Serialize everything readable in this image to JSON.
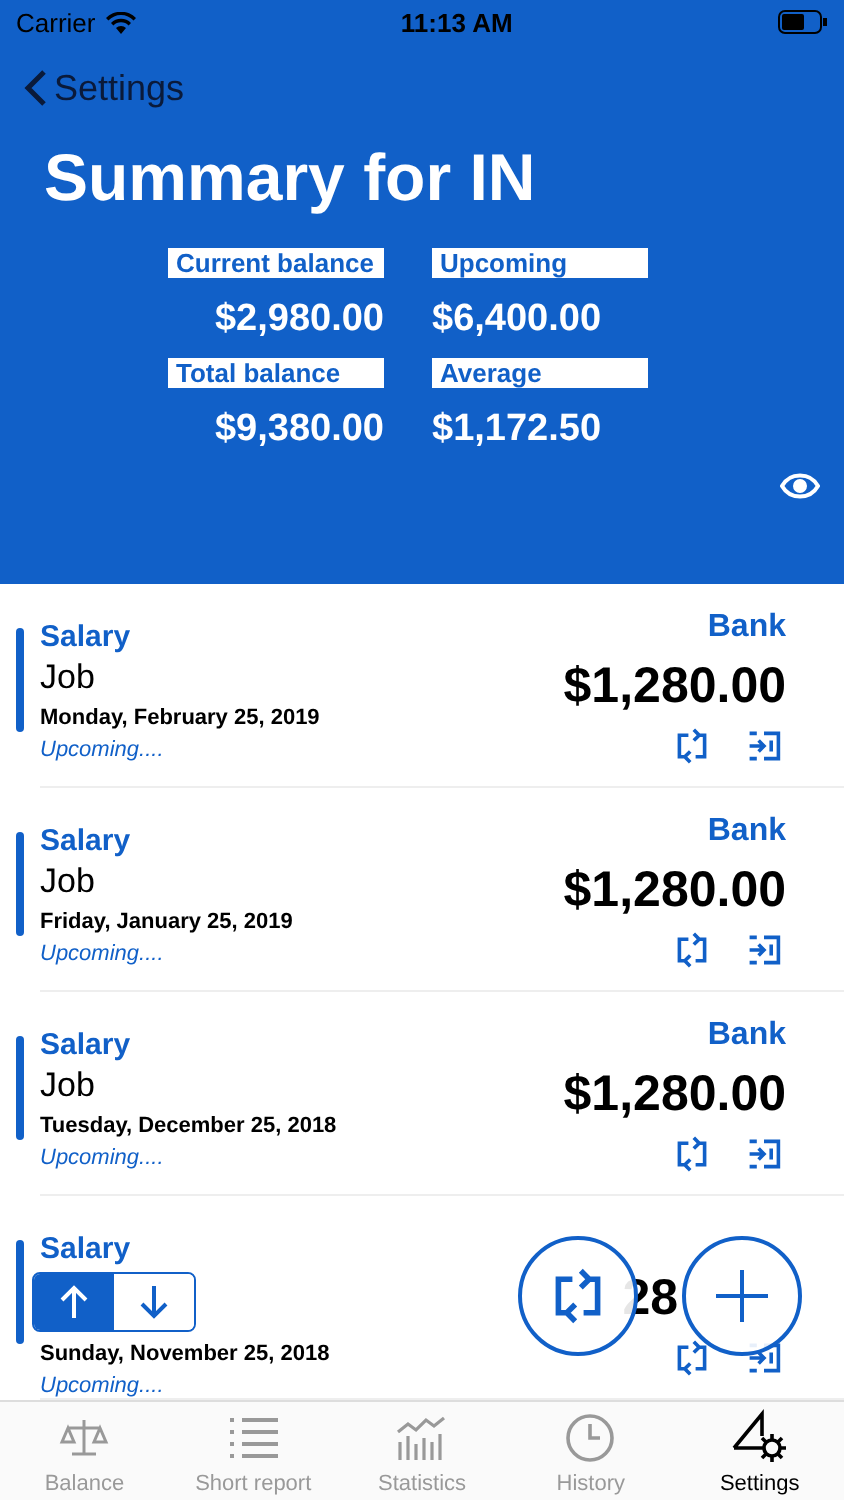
{
  "status_bar": {
    "carrier": "Carrier",
    "time": "11:13 AM"
  },
  "nav": {
    "back": "Settings",
    "title": "Summary for IN"
  },
  "summary": [
    {
      "label": "Current balance",
      "value": "$2,980.00"
    },
    {
      "label": "Upcoming",
      "value": "$6,400.00"
    },
    {
      "label": "Total balance",
      "value": "$9,380.00"
    },
    {
      "label": "Average",
      "value": "$1,172.50"
    }
  ],
  "transactions": [
    {
      "kind": "full",
      "category": "Salary",
      "note": "Job",
      "date": "Monday, February 25, 2019",
      "status": "Upcoming....",
      "account": "Bank",
      "amount": "$1,280.00"
    },
    {
      "kind": "full",
      "category": "Salary",
      "note": "Job",
      "date": "Friday, January 25, 2019",
      "status": "Upcoming....",
      "account": "Bank",
      "amount": "$1,280.00"
    },
    {
      "kind": "full",
      "category": "Salary",
      "note": "Job",
      "date": "Tuesday, December 25, 2018",
      "status": "Upcoming....",
      "account": "Bank",
      "amount": "$1,280.00"
    },
    {
      "kind": "covered",
      "category": "Salary",
      "date": "Sunday, November 25, 2018",
      "status": "Upcoming....",
      "amount": "28"
    }
  ],
  "sort_toggle": [
    {
      "selected": true
    },
    {
      "selected": false
    }
  ],
  "tabs": [
    {
      "label": "Balance",
      "selected": false
    },
    {
      "label": "Short report",
      "selected": false
    },
    {
      "label": "Statistics",
      "selected": false
    },
    {
      "label": "History",
      "selected": false
    },
    {
      "label": "Settings",
      "selected": true
    }
  ]
}
